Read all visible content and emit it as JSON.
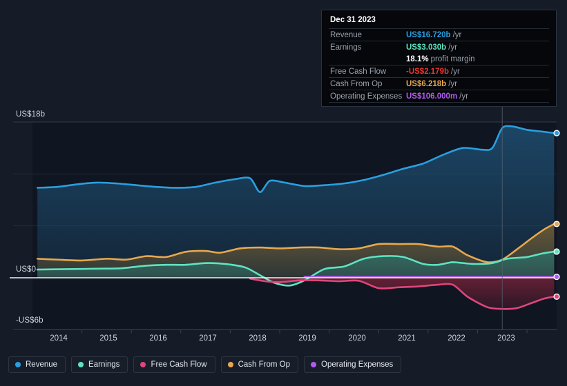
{
  "chart_data": {
    "type": "area",
    "title": "",
    "xlabel": "",
    "ylabel": "",
    "ylim": [
      -6,
      18
    ],
    "xlim": [
      2013.5,
      2024.1
    ],
    "grid": true,
    "legend_position": "bottom-left",
    "y_ticks": [
      {
        "label": "US$18b",
        "value": 18
      },
      {
        "label": "US$0",
        "value": 0
      },
      {
        "label": "-US$6b",
        "value": -6
      }
    ],
    "x_ticks": [
      "2014",
      "2015",
      "2016",
      "2017",
      "2018",
      "2019",
      "2020",
      "2021",
      "2022",
      "2023"
    ],
    "forecast_divider_year": 2023,
    "series": [
      {
        "name": "Revenue",
        "color": "#2a9fe0",
        "fill": "#1d4a6b",
        "x": [
          2013.6,
          2014.0,
          2014.4,
          2014.8,
          2015.2,
          2015.6,
          2016.0,
          2016.4,
          2016.8,
          2017.2,
          2017.6,
          2017.9,
          2018.1,
          2018.3,
          2018.6,
          2019.0,
          2019.4,
          2019.8,
          2020.2,
          2020.6,
          2021.0,
          2021.4,
          2021.8,
          2022.2,
          2022.6,
          2022.8,
          2023.0,
          2023.2,
          2023.5,
          2023.8,
          2024.05
        ],
        "values": [
          10.4,
          10.5,
          10.8,
          11.0,
          10.9,
          10.7,
          10.5,
          10.4,
          10.5,
          11.0,
          11.4,
          11.5,
          9.9,
          11.2,
          11.0,
          10.6,
          10.7,
          10.9,
          11.3,
          11.9,
          12.6,
          13.2,
          14.2,
          15.0,
          14.8,
          15.0,
          17.3,
          17.5,
          17.1,
          16.9,
          16.72
        ]
      },
      {
        "name": "Earnings",
        "color": "#5fe3c0",
        "fill": "#2e6d66",
        "x": [
          2013.6,
          2014.2,
          2014.8,
          2015.3,
          2015.8,
          2016.2,
          2016.6,
          2017.0,
          2017.4,
          2017.8,
          2018.1,
          2018.4,
          2018.7,
          2019.0,
          2019.4,
          2019.8,
          2020.2,
          2020.6,
          2021.0,
          2021.4,
          2021.7,
          2022.0,
          2022.4,
          2022.8,
          2023.1,
          2023.5,
          2023.8,
          2024.05
        ],
        "values": [
          0.95,
          1.0,
          1.05,
          1.1,
          1.4,
          1.5,
          1.5,
          1.7,
          1.6,
          1.2,
          0.3,
          -0.6,
          -0.9,
          -0.3,
          1.0,
          1.3,
          2.2,
          2.5,
          2.4,
          1.6,
          1.5,
          1.8,
          1.6,
          1.7,
          2.2,
          2.4,
          2.8,
          3.03
        ]
      },
      {
        "name": "Free Cash Flow",
        "color": "#e0457b",
        "fill": "#6b2035",
        "x": [
          2017.9,
          2018.2,
          2018.5,
          2018.9,
          2019.3,
          2019.7,
          2020.1,
          2020.5,
          2020.9,
          2021.3,
          2021.7,
          2022.0,
          2022.3,
          2022.7,
          2023.0,
          2023.3,
          2023.6,
          2023.85,
          2024.05
        ],
        "values": [
          -0.1,
          -0.4,
          -0.5,
          -0.3,
          -0.3,
          -0.4,
          -0.35,
          -1.2,
          -1.1,
          -1.0,
          -0.8,
          -0.8,
          -2.2,
          -3.4,
          -3.6,
          -3.5,
          -2.9,
          -2.4,
          -2.179
        ]
      },
      {
        "name": "Cash From Op",
        "color": "#e8a84f",
        "fill": "#6b5a33",
        "x": [
          2013.6,
          2014.0,
          2014.5,
          2015.0,
          2015.4,
          2015.8,
          2016.2,
          2016.6,
          2017.0,
          2017.3,
          2017.7,
          2018.1,
          2018.5,
          2018.9,
          2019.3,
          2019.7,
          2020.1,
          2020.5,
          2020.9,
          2021.3,
          2021.7,
          2022.0,
          2022.3,
          2022.7,
          2023.0,
          2023.3,
          2023.6,
          2023.85,
          2024.05
        ],
        "values": [
          2.2,
          2.1,
          2.0,
          2.2,
          2.1,
          2.5,
          2.4,
          3.0,
          3.1,
          2.9,
          3.4,
          3.5,
          3.4,
          3.5,
          3.5,
          3.3,
          3.4,
          3.9,
          3.9,
          3.9,
          3.6,
          3.6,
          2.6,
          1.8,
          2.1,
          3.3,
          4.6,
          5.6,
          6.218
        ]
      },
      {
        "name": "Operating Expenses",
        "color": "#b05cf0",
        "fill": "#4a2a6b",
        "x": [
          2019.0,
          2020.0,
          2021.0,
          2022.0,
          2023.0,
          2024.05
        ],
        "values": [
          0.12,
          0.11,
          0.11,
          0.11,
          0.11,
          0.106
        ]
      }
    ],
    "endpoints": [
      {
        "series": "Revenue",
        "value": 16.72
      },
      {
        "series": "Cash From Op",
        "value": 6.218
      },
      {
        "series": "Earnings",
        "value": 3.03
      },
      {
        "series": "Operating Expenses",
        "value": 0.106
      },
      {
        "series": "Free Cash Flow",
        "value": -2.179
      }
    ]
  },
  "tooltip": {
    "date": "Dec 31 2023",
    "rows": [
      {
        "label": "Revenue",
        "value": "US$16.720b",
        "unit": "/yr",
        "color": "#2a9fe0"
      },
      {
        "label": "Earnings",
        "value": "US$3.030b",
        "unit": "/yr",
        "color": "#5fe3c0"
      },
      {
        "label": "",
        "value": "18.1%",
        "unit": "profit margin",
        "color": "#ffffff"
      },
      {
        "label": "Free Cash Flow",
        "value": "-US$2.179b",
        "unit": "/yr",
        "color": "#e8392f"
      },
      {
        "label": "Cash From Op",
        "value": "US$6.218b",
        "unit": "/yr",
        "color": "#e8a84f"
      },
      {
        "label": "Operating Expenses",
        "value": "US$106.000m",
        "unit": "/yr",
        "color": "#b05cf0"
      }
    ]
  },
  "legend": {
    "items": [
      {
        "label": "Revenue",
        "color": "#2a9fe0"
      },
      {
        "label": "Earnings",
        "color": "#5fe3c0"
      },
      {
        "label": "Free Cash Flow",
        "color": "#e0457b"
      },
      {
        "label": "Cash From Op",
        "color": "#e8a84f"
      },
      {
        "label": "Operating Expenses",
        "color": "#b05cf0"
      }
    ]
  },
  "axes": {
    "y_labels": [
      "US$18b",
      "US$0",
      "-US$6b"
    ],
    "x_labels": [
      "2014",
      "2015",
      "2016",
      "2017",
      "2018",
      "2019",
      "2020",
      "2021",
      "2022",
      "2023"
    ]
  }
}
